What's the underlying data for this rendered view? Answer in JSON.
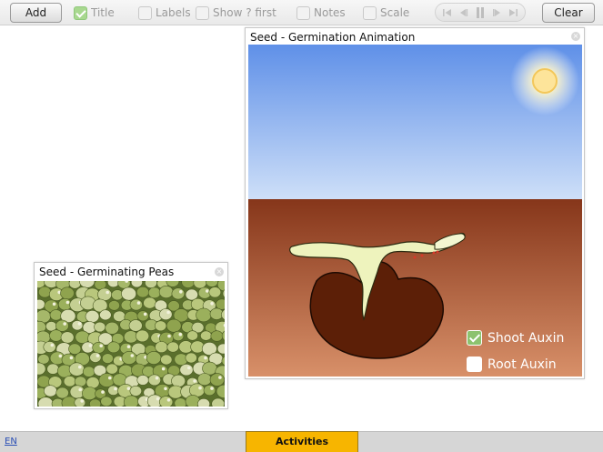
{
  "toolbar": {
    "add_label": "Add",
    "clear_label": "Clear",
    "options": [
      {
        "label": "Title",
        "checked": true
      },
      {
        "label": "Labels",
        "checked": false
      },
      {
        "label": "Show ? first",
        "checked": false
      },
      {
        "label": "Notes",
        "checked": false
      },
      {
        "label": "Scale",
        "checked": false
      }
    ],
    "player": {
      "buttons": [
        "skip-back-icon",
        "step-back-icon",
        "pause-icon",
        "step-forward-icon",
        "skip-forward-icon"
      ]
    }
  },
  "panels": {
    "animation": {
      "title": "Seed - Germination Animation",
      "toggles": [
        {
          "label": "Shoot Auxin",
          "checked": true
        },
        {
          "label": "Root Auxin",
          "checked": false
        }
      ]
    },
    "peas": {
      "title": "Seed - Germinating Peas"
    }
  },
  "footer": {
    "language": "EN",
    "activities_label": "Activities"
  },
  "colors": {
    "sky_top": "#5f90e8",
    "sky_bottom": "#c9ddf7",
    "soil_top": "#8b3a1a",
    "soil_bottom": "#d38b62",
    "seed": "#5c1f07",
    "shoot": "#f0f4c0",
    "accent": "#f7b500",
    "check": "#a8d88f"
  }
}
